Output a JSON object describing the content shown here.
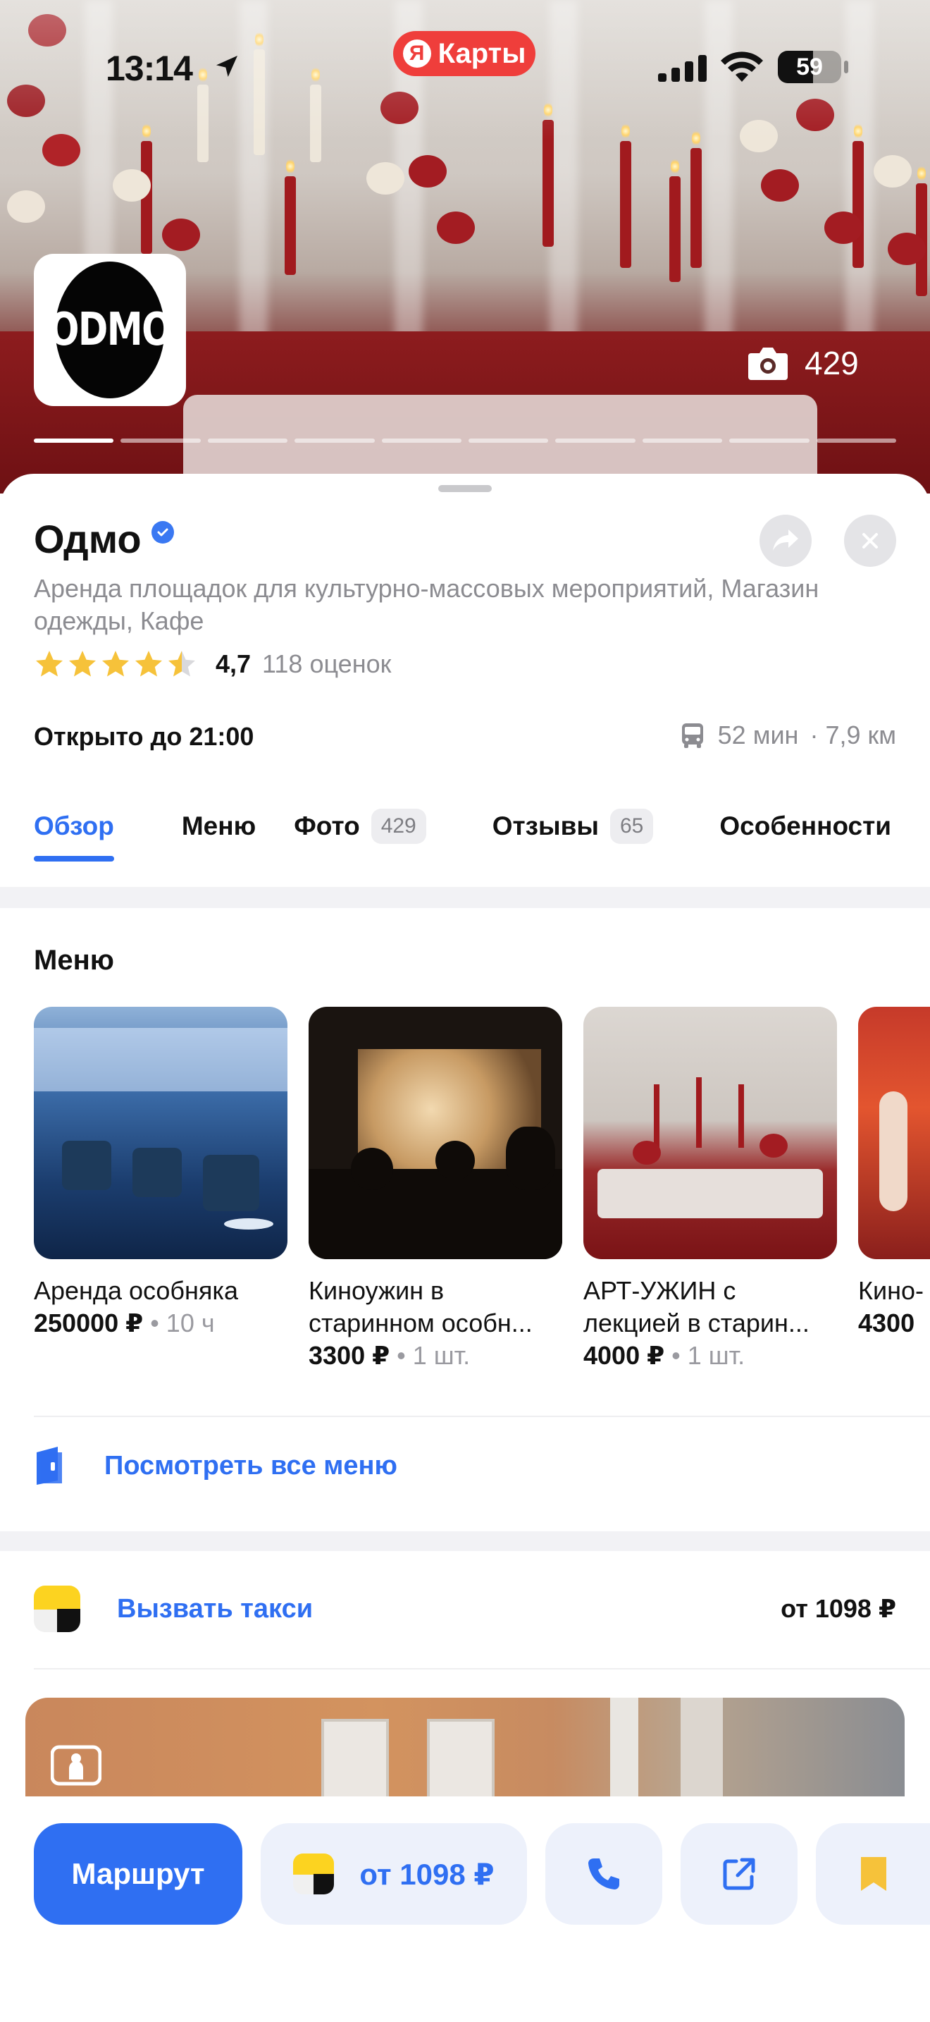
{
  "status_bar": {
    "time": "13:14",
    "app_name": "Карты",
    "app_logo_letter": "Я",
    "battery": "59"
  },
  "hero": {
    "brand_logo_text": "ODMO",
    "photo_count": "429",
    "gallery_position": 1,
    "gallery_total": 10
  },
  "place": {
    "name": "Одмо",
    "verified": true,
    "categories": "Аренда площадок для культурно-массовых мероприятий, Магазин одежды, Кафе",
    "rating": 4.5,
    "rating_value": "4,7",
    "rating_count": "118 оценок",
    "open_status": "Открыто до 21:00",
    "transit_time": "52 мин",
    "distance": "· 7,9 км"
  },
  "tabs": [
    {
      "label": "Обзор",
      "badge": "",
      "active": true
    },
    {
      "label": "Меню",
      "badge": ""
    },
    {
      "label": "Фото",
      "badge": "429"
    },
    {
      "label": "Отзывы",
      "badge": "65"
    },
    {
      "label": "Особенности",
      "badge": ""
    }
  ],
  "menu": {
    "title": "Меню",
    "items": [
      {
        "name": "Аренда особняка",
        "price": "250000 ₽",
        "unit": "• 10 ч"
      },
      {
        "name": "Киноужин в старинном особн...",
        "price": "3300 ₽",
        "unit": "• 1 шт."
      },
      {
        "name": "АРТ-УЖИН с лекцией в старин...",
        "price": "4000 ₽",
        "unit": "• 1 шт."
      },
      {
        "name": "Кино- МАМ",
        "price": "4300",
        "unit": ""
      }
    ],
    "see_all": "Посмотреть все меню"
  },
  "taxi": {
    "label": "Вызвать такси",
    "price": "от 1098 ₽"
  },
  "bottom_bar": {
    "route": "Маршрут",
    "taxi_price": "от 1098 ₽"
  },
  "colors": {
    "accent": "#2f6ff2",
    "yandex_red": "#ef3e3b",
    "star": "#f6c23a",
    "taxi_yellow": "#fcd320"
  }
}
